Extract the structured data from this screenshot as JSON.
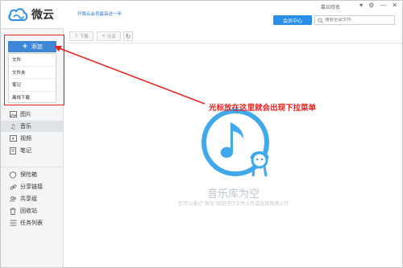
{
  "header": {
    "app_name": "微云",
    "promo_text": "开微云会员最高送一年",
    "user_name": "慕兰欣名",
    "member_center": "会员中心",
    "search_placeholder": "搜索全部文件",
    "window_controls": [
      "▾",
      "⚙",
      "—",
      "✕"
    ]
  },
  "sidebar": {
    "add_button": "添加",
    "add_menu": [
      "文件",
      "文件夹",
      "笔记",
      "离线下载"
    ],
    "nav_top": [
      {
        "label": "图片",
        "icon": "image-icon"
      },
      {
        "label": "音乐",
        "icon": "music-icon",
        "active": true
      },
      {
        "label": "视频",
        "icon": "video-icon"
      },
      {
        "label": "笔记",
        "icon": "note-icon"
      }
    ],
    "nav_bottom": [
      {
        "label": "保险箱",
        "icon": "shield-icon"
      },
      {
        "label": "分享链接",
        "icon": "link-icon"
      },
      {
        "label": "共享组",
        "icon": "group-icon"
      },
      {
        "label": "回收站",
        "icon": "trash-icon"
      },
      {
        "label": "任务列表",
        "icon": "task-list-icon"
      }
    ]
  },
  "toolbar": {
    "download": "下载",
    "share": "分享",
    "refresh_icon": "refresh-icon"
  },
  "main": {
    "empty_title": "音乐库为空",
    "empty_hint": "您可以通过\"添加\"按钮进行文件上传或直接拖拽上传"
  },
  "annotation": {
    "text": "光标放在这里就会出现下拉菜单",
    "color": "#e8231f"
  },
  "colors": {
    "accent": "#2a8ee6",
    "add_button": "#3e86d6",
    "empty_icon": "#3fa9ec"
  }
}
